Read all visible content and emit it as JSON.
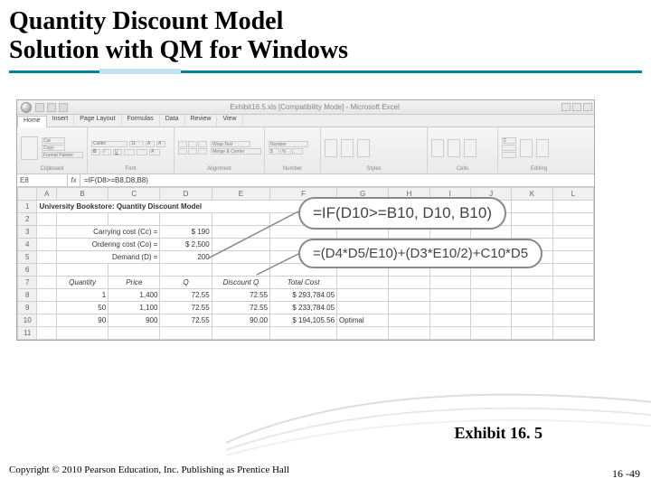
{
  "title_line1": "Quantity Discount Model",
  "title_line2": "Solution with QM for Windows",
  "window_title": "Exhibit16.5.xls [Compatibility Mode] - Microsoft Excel",
  "tabs": [
    "Home",
    "Insert",
    "Page Layout",
    "Formulas",
    "Data",
    "Review",
    "View"
  ],
  "ribbon": {
    "clipboard": {
      "label": "Clipboard",
      "cut": "Cut",
      "copy": "Copy",
      "fmt": "Format Painter"
    },
    "font": {
      "label": "Font"
    },
    "alignment": {
      "label": "Alignment",
      "wrap": "Wrap Text",
      "merge": "Merge & Center"
    },
    "number": {
      "label": "Number",
      "val": "Number"
    },
    "styles": {
      "label": "Styles",
      "cf": "Conditional Formatting",
      "ft": "Format as Table",
      "cs": "Cell Styles"
    },
    "cells": {
      "label": "Cells",
      "ins": "Insert",
      "del": "Delete",
      "fmt": "Format"
    },
    "editing": {
      "label": "Editing",
      "sort": "Sort & Filter",
      "find": "Find & Select"
    }
  },
  "namebox": "E8",
  "formula_bar": "=IF(D8>=B8,D8,B8)",
  "columns": [
    "A",
    "B",
    "C",
    "D",
    "E",
    "F",
    "G",
    "H",
    "I",
    "J",
    "K",
    "L"
  ],
  "rows": {
    "1": {
      "A": "University Bookstore: Quantity Discount Model"
    },
    "3": {
      "B": "Carrying cost (Cc) =",
      "D": "$   190"
    },
    "4": {
      "B": "Ordering cost (Co) =",
      "D": "$  2,500"
    },
    "5": {
      "B": "Demand (D) =",
      "D": "200"
    },
    "7": {
      "B": "Quantity",
      "C": "Price",
      "D": "Q",
      "E": "Discount Q",
      "F": "Total Cost"
    },
    "8": {
      "B": "1",
      "C": "1,400",
      "D": "72.55",
      "E": "72.55",
      "F": "$   293,784.05"
    },
    "9": {
      "B": "50",
      "C": "1,100",
      "D": "72.55",
      "E": "72.55",
      "F": "$   233,784.05"
    },
    "10": {
      "B": "90",
      "C": "900",
      "D": "72.55",
      "E": "90.00",
      "F": "$   194,105.56",
      "G": "Optimal"
    }
  },
  "callouts": {
    "formula1": "=IF(D10>=B10, D10, B10)",
    "formula2": "=(D4*D5/E10)+(D3*E10/2)+C10*D5"
  },
  "exhibit": "Exhibit 16. 5",
  "copyright": "Copyright © 2010 Pearson Education, Inc. Publishing as Prentice Hall",
  "pagenum": "16 -49"
}
